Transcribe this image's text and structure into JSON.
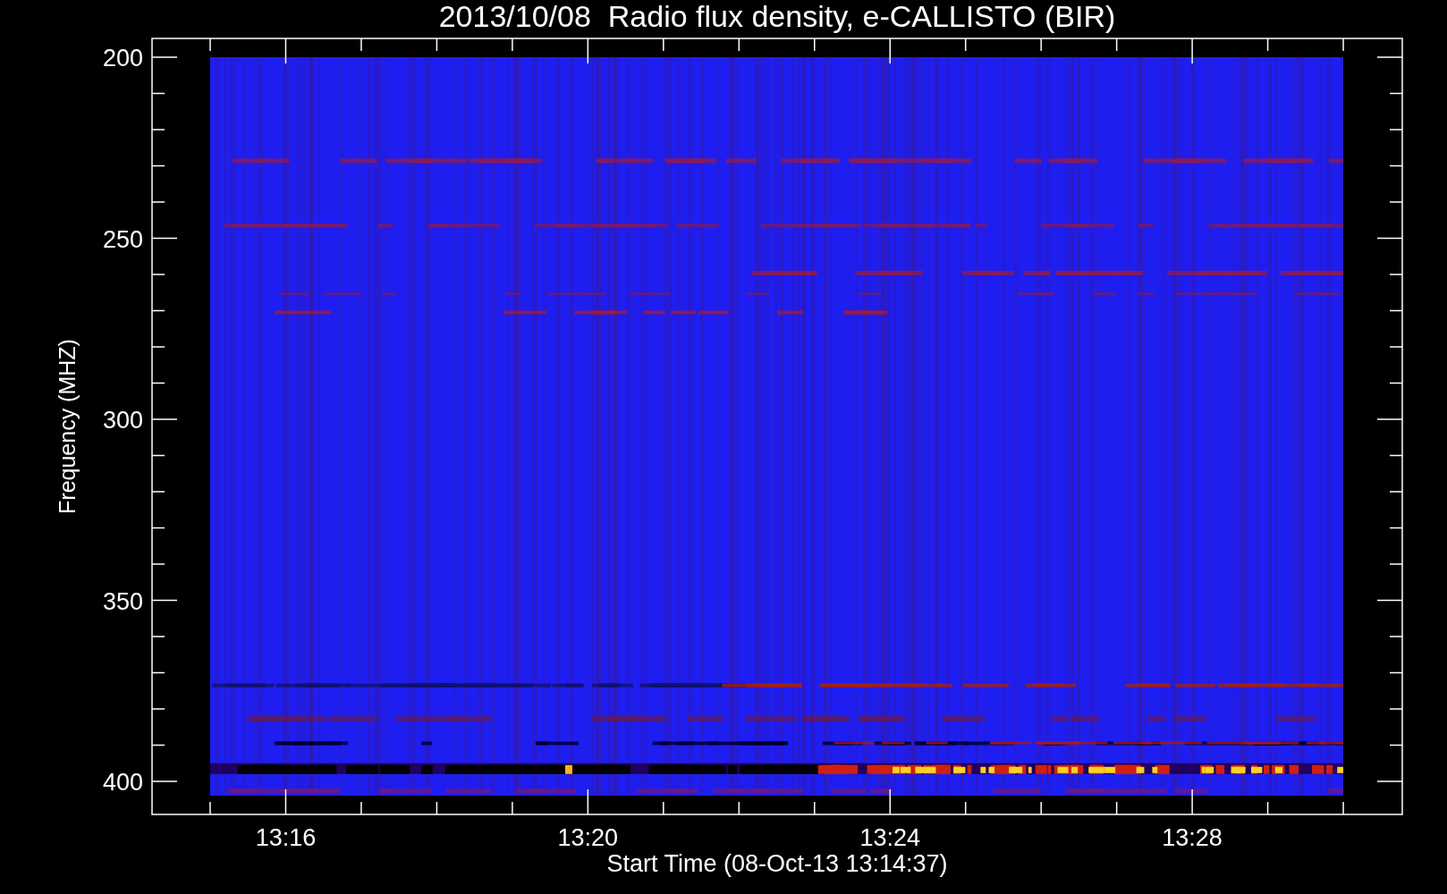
{
  "title": "2013/10/08  Radio flux density, e-CALLISTO (BIR)",
  "y_axis": {
    "label": "Frequency (MHZ)",
    "tick_labels": [
      "200",
      "250",
      "300",
      "350",
      "400"
    ]
  },
  "x_axis": {
    "label": "Start Time (08-Oct-13 13:14:37)",
    "tick_labels": [
      "13:16",
      "13:20",
      "13:24",
      "13:28"
    ]
  }
}
